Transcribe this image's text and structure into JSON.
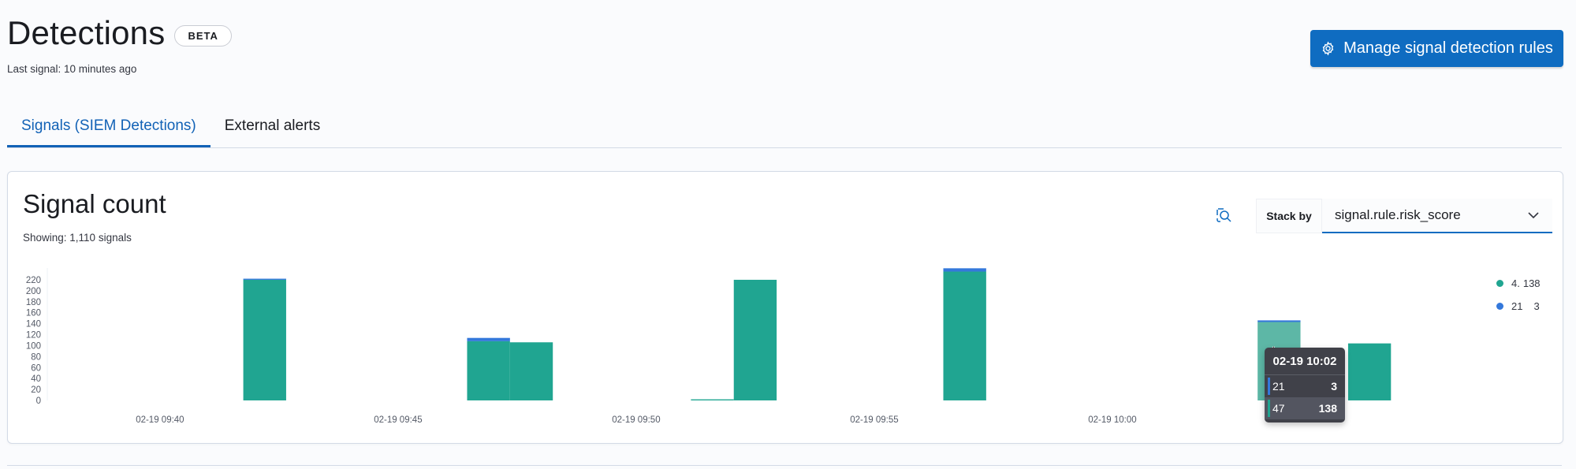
{
  "header": {
    "title": "Detections",
    "badge": "BETA",
    "last_signal": "Last signal: 10 minutes ago"
  },
  "toolbar": {
    "manage_label": "Manage signal detection rules",
    "manage_icon": "gear-icon"
  },
  "tabs": [
    {
      "label": "Signals (SIEM Detections)",
      "active": true
    },
    {
      "label": "External alerts",
      "active": false
    }
  ],
  "panel": {
    "title": "Signal count",
    "showing": "Showing: 1,110 signals",
    "stack_label": "Stack by",
    "stack_value": "signal.rule.risk_score",
    "inspect_icon": "inspect-icon"
  },
  "legend": [
    {
      "name": "4.",
      "value": "138",
      "color": "#20a591"
    },
    {
      "name": "21",
      "value": "3",
      "color": "#3478db"
    }
  ],
  "tooltip": {
    "title": "02-19 10:02",
    "rows": [
      {
        "label": "21",
        "value": "3",
        "color": "#3478db"
      },
      {
        "label": "47",
        "value": "138",
        "color": "#20a591"
      }
    ]
  },
  "colors": {
    "accent": "#0f6cc1",
    "series_primary": "#20a591",
    "series_secondary": "#3478db"
  },
  "chart_data": {
    "type": "bar",
    "stacked": true,
    "y_ticks": [
      0,
      20,
      40,
      60,
      80,
      100,
      120,
      140,
      160,
      180,
      200,
      220
    ],
    "ylim": [
      0,
      230
    ],
    "x_ticks": [
      "02-19 09:40",
      "02-19 09:45",
      "02-19 09:50",
      "02-19 09:55",
      "02-19 10:00"
    ],
    "x_tick_minutes": [
      40,
      45,
      50,
      55,
      60
    ],
    "xlim_minutes": [
      37.8,
      67.6
    ],
    "bar_width_minutes": 0.9,
    "bars": [
      {
        "x_minutes": 42.2,
        "values": [
          220,
          2
        ]
      },
      {
        "x_minutes": 46.9,
        "values": [
          108,
          6
        ]
      },
      {
        "x_minutes": 47.8,
        "values": [
          106,
          0
        ]
      },
      {
        "x_minutes": 51.6,
        "values": [
          2,
          0
        ]
      },
      {
        "x_minutes": 52.5,
        "values": [
          220,
          0
        ]
      },
      {
        "x_minutes": 56.9,
        "values": [
          235,
          6
        ]
      },
      {
        "x_minutes": 63.5,
        "values": [
          143,
          3
        ],
        "highlighted": true
      },
      {
        "x_minutes": 65.4,
        "values": [
          104,
          0
        ]
      }
    ],
    "series": [
      {
        "name": "47",
        "color": "#20a591"
      },
      {
        "name": "21",
        "color": "#3478db"
      }
    ],
    "highlight_color": "#5db7a6",
    "grid": false
  }
}
